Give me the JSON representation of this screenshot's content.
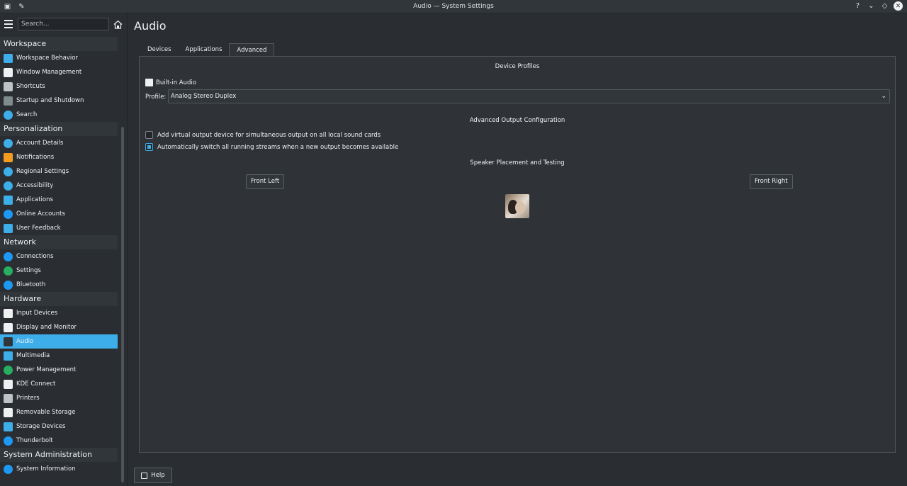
{
  "window": {
    "title": "Audio — System Settings",
    "controls": [
      "?",
      "⌄",
      "◇",
      "✕"
    ]
  },
  "search": {
    "placeholder": "Search..."
  },
  "sidebar": {
    "categories": [
      {
        "label": "Workspace",
        "items": [
          {
            "label": "Workspace Behavior",
            "icon": "workspace-behavior-icon",
            "color": "#3daee9"
          },
          {
            "label": "Window Management",
            "icon": "window-management-icon",
            "color": "#eff0f1"
          },
          {
            "label": "Shortcuts",
            "icon": "keyboard-icon",
            "color": "#bdc3c7"
          },
          {
            "label": "Startup and Shutdown",
            "icon": "startup-icon",
            "color": "#7f8c8d"
          },
          {
            "label": "Search",
            "icon": "search-icon",
            "color": "#3daee9"
          }
        ]
      },
      {
        "label": "Personalization",
        "items": [
          {
            "label": "Account Details",
            "icon": "user-icon",
            "color": "#3daee9"
          },
          {
            "label": "Notifications",
            "icon": "bell-icon",
            "color": "#f39c1f"
          },
          {
            "label": "Regional Settings",
            "icon": "globe-flag-icon",
            "color": "#3daee9"
          },
          {
            "label": "Accessibility",
            "icon": "accessibility-icon",
            "color": "#3daee9"
          },
          {
            "label": "Applications",
            "icon": "applications-icon",
            "color": "#3daee9"
          },
          {
            "label": "Online Accounts",
            "icon": "online-accounts-icon",
            "color": "#1d99f3"
          },
          {
            "label": "User Feedback",
            "icon": "feedback-icon",
            "color": "#3daee9"
          }
        ]
      },
      {
        "label": "Network",
        "items": [
          {
            "label": "Connections",
            "icon": "globe-icon",
            "color": "#1d99f3"
          },
          {
            "label": "Settings",
            "icon": "network-settings-icon",
            "color": "#27ae60"
          },
          {
            "label": "Bluetooth",
            "icon": "bluetooth-icon",
            "color": "#1d99f3"
          }
        ]
      },
      {
        "label": "Hardware",
        "items": [
          {
            "label": "Input Devices",
            "icon": "keyboard-icon",
            "color": "#eff0f1"
          },
          {
            "label": "Display and Monitor",
            "icon": "monitor-icon",
            "color": "#eff0f1"
          },
          {
            "label": "Audio",
            "icon": "speaker-icon",
            "color": "#31363b",
            "active": true
          },
          {
            "label": "Multimedia",
            "icon": "multimedia-icon",
            "color": "#3daee9"
          },
          {
            "label": "Power Management",
            "icon": "power-icon",
            "color": "#27ae60"
          },
          {
            "label": "KDE Connect",
            "icon": "phone-icon",
            "color": "#eff0f1"
          },
          {
            "label": "Printers",
            "icon": "printer-icon",
            "color": "#bdc3c7"
          },
          {
            "label": "Removable Storage",
            "icon": "usb-icon",
            "color": "#eff0f1"
          },
          {
            "label": "Storage Devices",
            "icon": "storage-icon",
            "color": "#3daee9"
          },
          {
            "label": "Thunderbolt",
            "icon": "thunderbolt-icon",
            "color": "#1d99f3"
          }
        ]
      },
      {
        "label": "System Administration",
        "items": [
          {
            "label": "System Information",
            "icon": "info-icon",
            "color": "#1d99f3"
          }
        ]
      }
    ]
  },
  "main": {
    "title": "Audio",
    "tabs": [
      {
        "label": "Devices",
        "active": false
      },
      {
        "label": "Applications",
        "active": false
      },
      {
        "label": "Advanced",
        "active": true
      }
    ],
    "device_profiles_title": "Device Profiles",
    "card_name": "Built-in Audio",
    "profile_label": "Profile:",
    "profile_value": "Analog Stereo Duplex",
    "advanced_output_title": "Advanced Output Configuration",
    "checkbox_virtual": {
      "label": "Add virtual output device for simultaneous output on all local sound cards",
      "checked": false
    },
    "checkbox_autoswitch": {
      "label": "Automatically switch all running streams when a new output becomes available",
      "checked": true
    },
    "speaker_title": "Speaker Placement and Testing",
    "front_left": "Front Left",
    "front_right": "Front Right",
    "help_label": "Help"
  }
}
